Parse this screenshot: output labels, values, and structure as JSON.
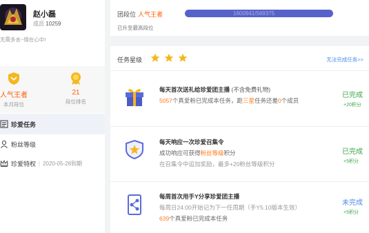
{
  "user": {
    "name": "赵小磊",
    "id_label": "成员",
    "id_value": "10259",
    "signature": "无需多言~情在心中!"
  },
  "stats": [
    {
      "value": "人气王者",
      "label": "本月段位",
      "icon": "shield-badge-icon"
    },
    {
      "value": "21",
      "label": "段位排名",
      "icon": "medal-icon"
    }
  ],
  "menu": [
    {
      "label": "珍爱任务",
      "icon": "task-list-icon",
      "active": true
    },
    {
      "label": "粉丝等级",
      "icon": "person-icon",
      "active": false
    },
    {
      "label": "珍爱特权",
      "icon": "crown-icon",
      "separator": "|",
      "date": "2020-05-28到期",
      "active": false
    }
  ],
  "rank": {
    "label": "团段位",
    "level": "人气王者",
    "progress_text": "1600941/569375",
    "note": "已升至最高段位"
  },
  "tasks": {
    "header": "任务星级",
    "star_count": 3,
    "view_done": "无法完成任务>>",
    "items": [
      {
        "title": "每天首次送礼给珍爱团主播",
        "title_note": "(不含免费礼物)",
        "line1_a": "5057",
        "line1_b": "个真爱粉已完成本任务，距",
        "line1_c": "三星",
        "line1_d": "任务还差",
        "line1_e": "0",
        "line1_f": "个成员",
        "status": "已完成",
        "points": "+20积分",
        "icon": "gift-icon"
      },
      {
        "title": "每天响应一次珍爱召集令",
        "line1_a": "成功响应可获得",
        "line1_b": "粉丝等级",
        "line1_c": "积分",
        "line2": "在召集令中追加奖励，最多+20粉丝等级积分",
        "status": "已完成",
        "points": "+5积分",
        "icon": "star-shield-icon"
      },
      {
        "title": "每周首次用手Y分享珍爱团主播",
        "line1": "每周日24:00开始记为下一任周期（手Y5.10版本生效）",
        "line2_a": "639",
        "line2_b": "个真爱粉已完成本任务",
        "status": "未完成",
        "points": "+5积分",
        "icon": "share-phone-icon"
      }
    ]
  },
  "colors": {
    "accent_orange": "#ff5a00",
    "done_green": "#3aa648",
    "link_blue": "#4a8eea",
    "progress_bar": "#5662c9",
    "star_gold": "#f5b71e"
  }
}
